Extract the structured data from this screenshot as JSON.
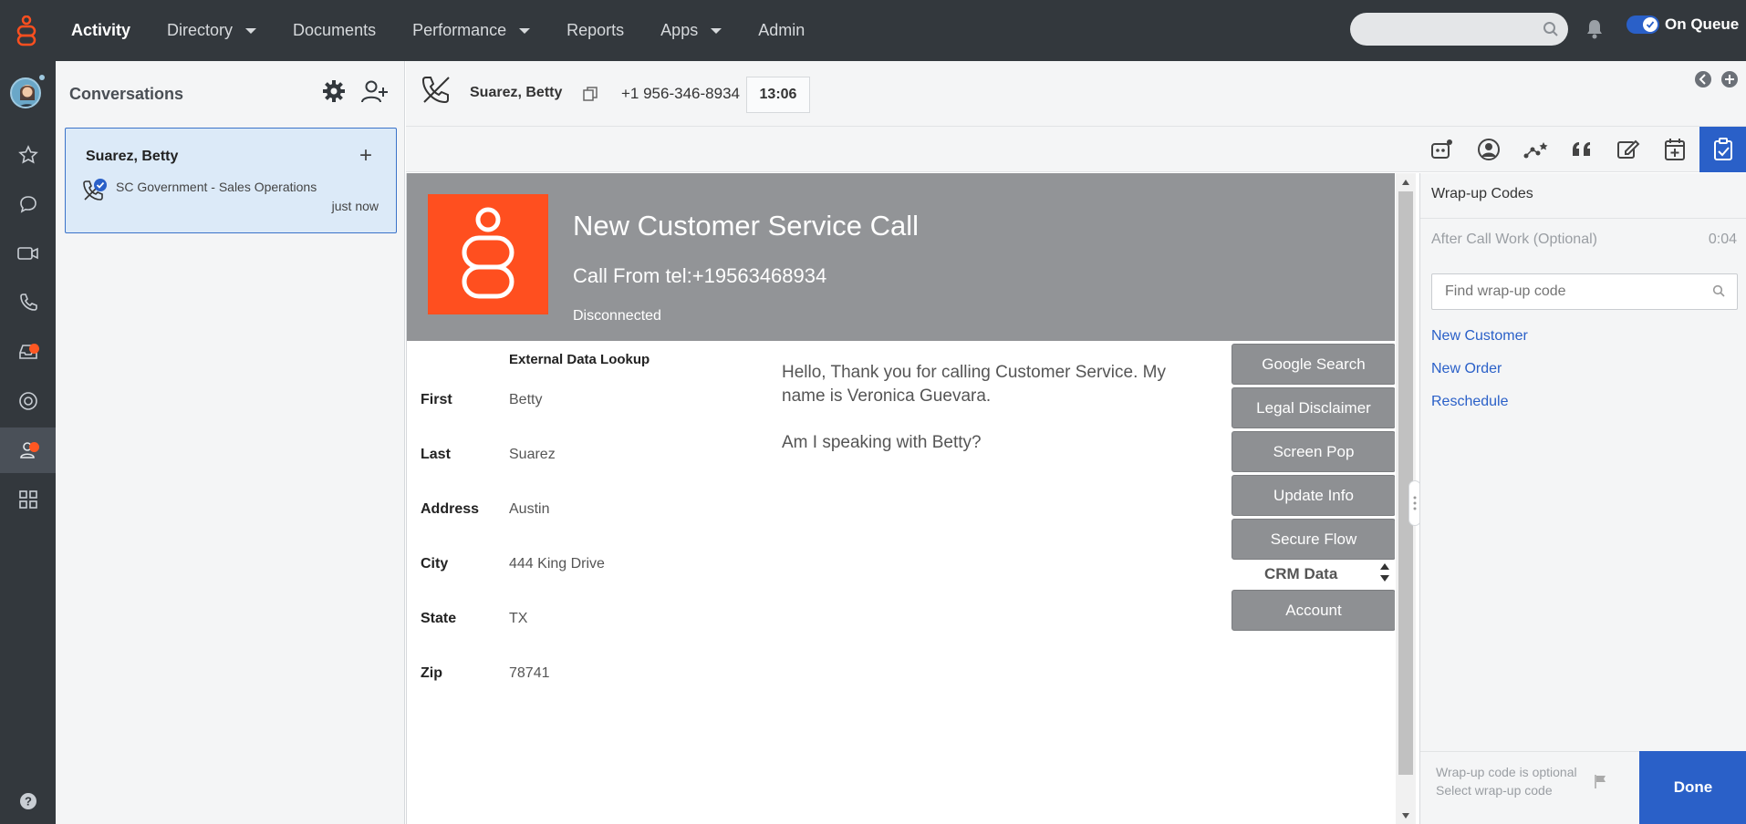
{
  "nav": {
    "items": [
      {
        "label": "Activity",
        "active": true,
        "dropdown": false
      },
      {
        "label": "Directory",
        "active": false,
        "dropdown": true
      },
      {
        "label": "Documents",
        "active": false,
        "dropdown": false
      },
      {
        "label": "Performance",
        "active": false,
        "dropdown": true
      },
      {
        "label": "Reports",
        "active": false,
        "dropdown": false
      },
      {
        "label": "Apps",
        "active": false,
        "dropdown": true
      },
      {
        "label": "Admin",
        "active": false,
        "dropdown": false
      }
    ],
    "queue_label": "On Queue",
    "queue_on": true
  },
  "colors": {
    "topbar": "#33383d",
    "accent": "#2a60c8",
    "brand_orange": "#ff4f1f",
    "notification": "#ff5722",
    "banner": "#929497"
  },
  "rail": {
    "icons": [
      "star-icon",
      "chat-icon",
      "video-icon",
      "phone-icon",
      "inbox-icon",
      "target-icon",
      "agent-icon",
      "apps-icon",
      "help-icon"
    ]
  },
  "conversations": {
    "title": "Conversations",
    "card": {
      "name": "Suarez, Betty",
      "queue": "SC Government - Sales Operations",
      "time": "just now"
    }
  },
  "call": {
    "name": "Suarez, Betty",
    "phone": "+1 956-346-8934",
    "timer": "13:06"
  },
  "script": {
    "title": "New Customer Service Call",
    "call_from": "Call From tel:+19563468934",
    "status": "Disconnected",
    "lookup_title": "External Data Lookup",
    "fields": [
      {
        "label": "First",
        "value": "Betty"
      },
      {
        "label": "Last",
        "value": "Suarez"
      },
      {
        "label": "Address",
        "value": "Austin"
      },
      {
        "label": "City",
        "value": "444 King Drive"
      },
      {
        "label": "State",
        "value": "TX"
      },
      {
        "label": "Zip",
        "value": "78741"
      }
    ],
    "greeting_1": "Hello, Thank you for calling Customer Service. My name is Veronica Guevara.",
    "greeting_2": "Am I speaking with Betty?",
    "buttons": [
      "Google Search",
      "Legal Disclaimer",
      "Screen Pop",
      "Update Info",
      "Secure Flow"
    ],
    "crm_label": "CRM Data",
    "account_button": "Account"
  },
  "wrapup": {
    "title": "Wrap-up Codes",
    "acw_label": "After Call Work (Optional)",
    "acw_time": "0:04",
    "search_placeholder": "Find wrap-up code",
    "codes": [
      "New Customer",
      "New Order",
      "Reschedule"
    ],
    "footer_line1": "Wrap-up code is optional",
    "footer_line2": "Select wrap-up code",
    "done_label": "Done"
  }
}
